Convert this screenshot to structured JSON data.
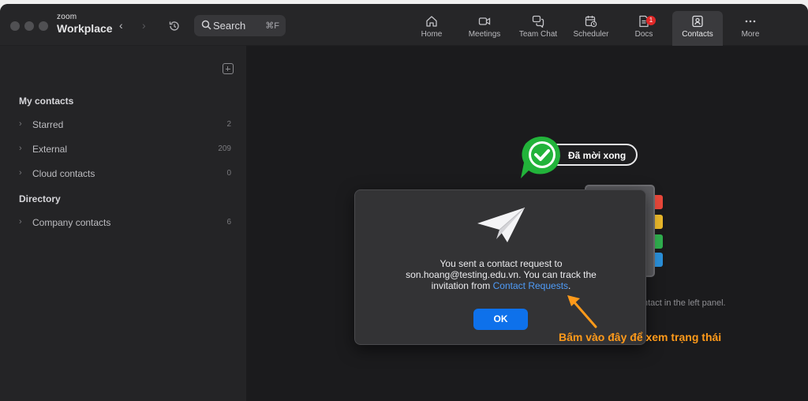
{
  "titlebar": {
    "brand_small": "zoom",
    "brand_big": "Workplace",
    "search_label": "Search",
    "search_shortcut": "⌘F"
  },
  "tabs": [
    {
      "label": "Home",
      "icon": "home-icon"
    },
    {
      "label": "Meetings",
      "icon": "video-camera-icon"
    },
    {
      "label": "Team Chat",
      "icon": "chat-bubbles-icon"
    },
    {
      "label": "Scheduler",
      "icon": "calendar-clock-icon"
    },
    {
      "label": "Docs",
      "icon": "document-icon",
      "badge": "1"
    },
    {
      "label": "Contacts",
      "icon": "contacts-icon",
      "active": true
    },
    {
      "label": "More",
      "icon": "ellipsis-icon"
    }
  ],
  "sidebar": {
    "my_contacts_title": "My contacts",
    "items": [
      {
        "label": "Starred",
        "count": "2"
      },
      {
        "label": "External",
        "count": "209"
      },
      {
        "label": "Cloud contacts",
        "count": "0"
      }
    ],
    "directory_title": "Directory",
    "directory_items": [
      {
        "label": "Company contacts",
        "count": "6"
      }
    ]
  },
  "main": {
    "hint_text": "ntact in the left panel."
  },
  "dialog": {
    "line1": "You sent a contact request to",
    "line2": "son.hoang@testing.edu.vn. You can track the",
    "line3_prefix": "invitation from ",
    "link_text": "Contact Requests",
    "line3_suffix": ".",
    "ok_label": "OK"
  },
  "annotations": {
    "done_label": "Đã mời xong",
    "callout_text": "Bấm vào đây để xem trạng thái",
    "accent_color": "#ff9a1a",
    "check_color": "#22b33a"
  }
}
